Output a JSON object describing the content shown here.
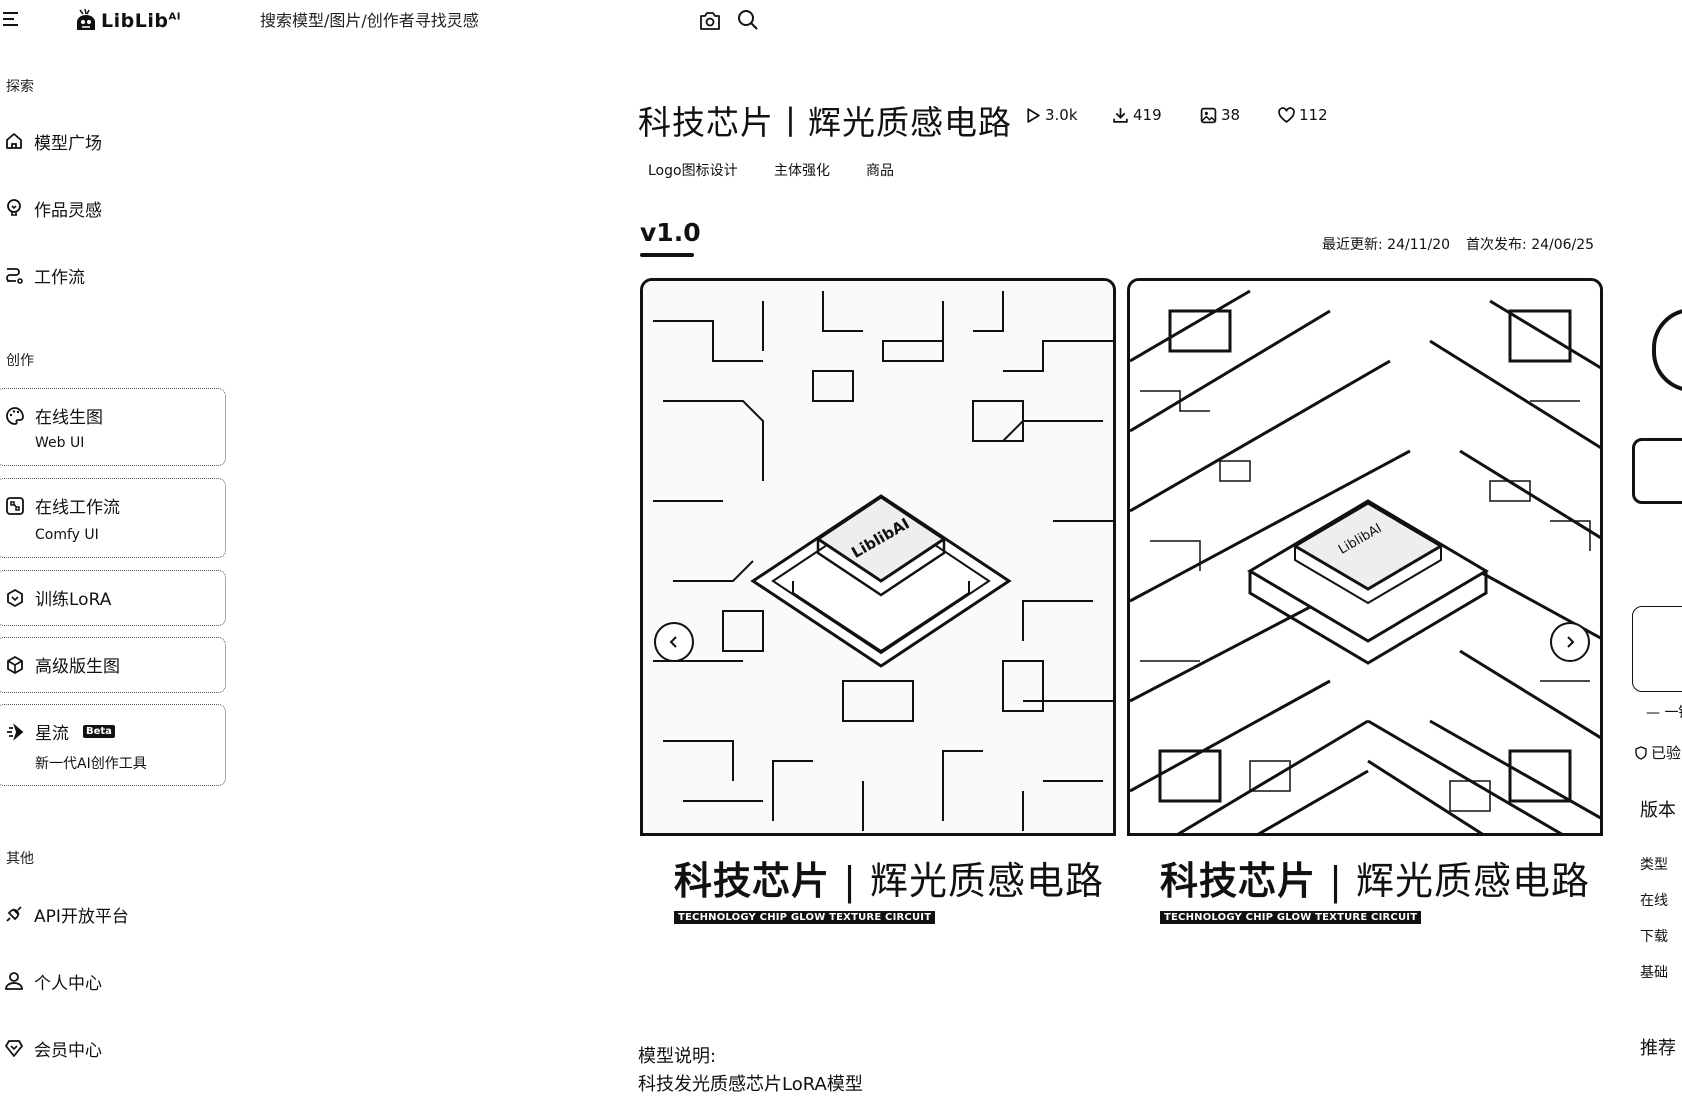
{
  "header": {
    "logo_text": "LibLib",
    "logo_sup": "AI",
    "search_placeholder": "搜索模型/图片/创作者寻找灵感",
    "icons": [
      "menu-icon",
      "camera-icon",
      "search-icon"
    ]
  },
  "sidebar": {
    "explore_title": "探索",
    "explore_items": [
      {
        "label": "模型广场",
        "icon": "home-icon"
      },
      {
        "label": "作品灵感",
        "icon": "lightbulb-icon"
      },
      {
        "label": "工作流",
        "icon": "workflow-icon"
      }
    ],
    "create_title": "创作",
    "create_cards": [
      {
        "label": "在线生图",
        "sub": "Web UI",
        "icon": "palette-icon"
      },
      {
        "label": "在线工作流",
        "sub": "Comfy UI",
        "icon": "comfy-icon"
      },
      {
        "label": "训练LoRA",
        "sub": "",
        "icon": "cube-icon"
      },
      {
        "label": "高级版生图",
        "sub": "",
        "icon": "box-icon"
      },
      {
        "label": "星流",
        "badge": "Beta",
        "sub": "新一代AI创作工具",
        "icon": "star-flow-icon"
      }
    ],
    "other_title": "其他",
    "other_items": [
      {
        "label": "API开放平台",
        "icon": "api-icon"
      },
      {
        "label": "个人中心",
        "icon": "user-icon"
      },
      {
        "label": "会员中心",
        "icon": "diamond-icon"
      }
    ]
  },
  "model": {
    "title": "科技芯片丨辉光质感电路",
    "stats": {
      "runs": "3.0k",
      "downloads": "419",
      "images": "38",
      "likes": "112"
    },
    "tags": [
      "Logo图标设计",
      "主体强化",
      "商品"
    ],
    "version": "v1.0",
    "updated_label": "最近更新: 24/11/20",
    "published_label": "首次发布: 24/06/25",
    "gallery": [
      {
        "caption_bold": "科技芯片",
        "caption_light": "辉光质感电路",
        "caption_sub": "TECHNOLOGY CHIP GLOW TEXTURE CIRCUIT",
        "chip_text": "LiblibAI"
      },
      {
        "caption_bold": "科技芯片",
        "caption_light": "辉光质感电路",
        "caption_sub": "TECHNOLOGY CHIP GLOW TEXTURE CIRCUIT",
        "chip_text": "LiblibAI"
      }
    ],
    "description_title": "模型说明:",
    "description_text": "科技发光质感芯片LoRA模型"
  },
  "right_panel": {
    "one_click": "一键",
    "verified": "已验",
    "version_info": "版本",
    "type": "类型",
    "online": "在线",
    "downloads": "下载",
    "base": "基础",
    "recommend": "推荐"
  }
}
